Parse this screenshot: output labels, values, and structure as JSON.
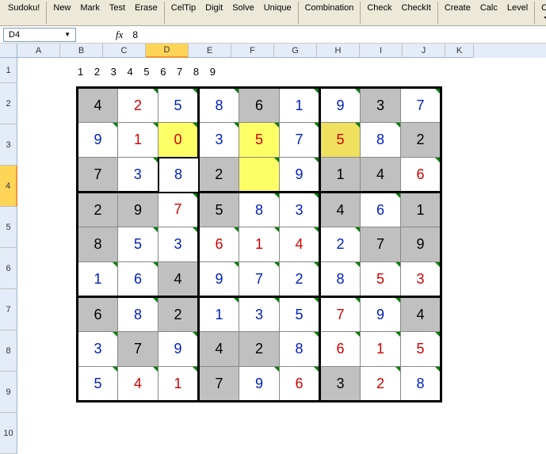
{
  "menu": {
    "m0": "Sudoku!",
    "m1": "New",
    "m2": "Mark",
    "m3": "Test",
    "m4": "Erase",
    "m5": "CelTip",
    "m6": "Digit",
    "m7": "Solve",
    "m8": "Unique",
    "m9": "Combination",
    "m10": "Check",
    "m11": "CheckIt",
    "m12": "Create",
    "m13": "Calc",
    "m14": "Level",
    "m15": "Cleanup"
  },
  "namebox": {
    "ref": "D4"
  },
  "formula": {
    "fx": "fx",
    "val": "8"
  },
  "cols": {
    "A": "A",
    "B": "B",
    "C": "C",
    "D": "D",
    "E": "E",
    "F": "F",
    "G": "G",
    "H": "H",
    "I": "I",
    "J": "J",
    "K": "K"
  },
  "rows": {
    "r1": "1",
    "r2": "2",
    "r3": "3",
    "r4": "4",
    "r5": "5",
    "r6": "6",
    "r7": "7",
    "r8": "8",
    "r9": "9",
    "r10": "10"
  },
  "digits": "1 2 3 4 5 6 7 8 9",
  "g": {
    "r1": {
      "c1": "4",
      "c2": "2",
      "c3": "5",
      "c4": "8",
      "c5": "6",
      "c6": "1",
      "c7": "9",
      "c8": "3",
      "c9": "7"
    },
    "r2": {
      "c1": "9",
      "c2": "1",
      "c3": "0",
      "c4": "3",
      "c5": "5",
      "c6": "7",
      "c7": "5",
      "c8": "8",
      "c9": "2"
    },
    "r3": {
      "c1": "7",
      "c2": "3",
      "c3": "8",
      "c4": "2",
      "c5": "",
      "c6": "9",
      "c7": "1",
      "c8": "4",
      "c9": "6"
    },
    "r4": {
      "c1": "2",
      "c2": "9",
      "c3": "7",
      "c4": "5",
      "c5": "8",
      "c6": "3",
      "c7": "4",
      "c8": "6",
      "c9": "1"
    },
    "r5": {
      "c1": "8",
      "c2": "5",
      "c3": "3",
      "c4": "6",
      "c5": "1",
      "c6": "4",
      "c7": "2",
      "c8": "7",
      "c9": "9"
    },
    "r6": {
      "c1": "1",
      "c2": "6",
      "c3": "4",
      "c4": "9",
      "c5": "7",
      "c6": "2",
      "c7": "8",
      "c8": "5",
      "c9": "3"
    },
    "r7": {
      "c1": "6",
      "c2": "8",
      "c3": "2",
      "c4": "1",
      "c5": "3",
      "c6": "5",
      "c7": "7",
      "c8": "9",
      "c9": "4"
    },
    "r8": {
      "c1": "3",
      "c2": "7",
      "c3": "9",
      "c4": "4",
      "c5": "2",
      "c6": "8",
      "c7": "6",
      "c8": "1",
      "c9": "5"
    },
    "r9": {
      "c1": "5",
      "c2": "4",
      "c3": "1",
      "c4": "7",
      "c5": "9",
      "c6": "6",
      "c7": "3",
      "c8": "2",
      "c9": "8"
    }
  }
}
